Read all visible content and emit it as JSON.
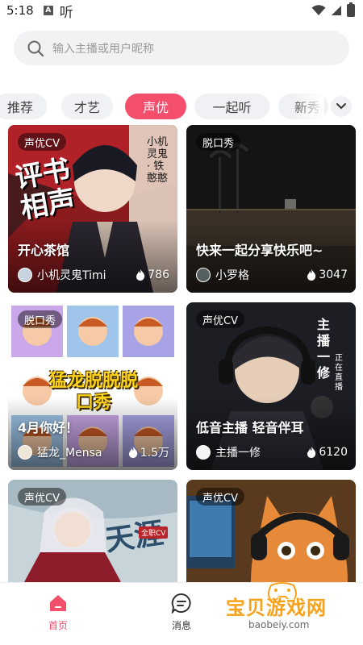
{
  "status_bar": {
    "time": "5:18",
    "notif_letter": "A",
    "app_glyph": "听"
  },
  "search": {
    "placeholder": "输入主播或用户昵称"
  },
  "tabs": [
    {
      "label": "推荐",
      "active": false
    },
    {
      "label": "才艺",
      "active": false
    },
    {
      "label": "声优",
      "active": true
    },
    {
      "label": "一起听",
      "active": false
    },
    {
      "label": "新秀",
      "active": false
    }
  ],
  "cards": [
    {
      "tag": "声优CV",
      "title": "开心茶馆",
      "host": "小机灵鬼Timi",
      "heat": "786",
      "art_text": "评书相声",
      "side_text": "小机灵鬼 · 铁憨憨"
    },
    {
      "tag": "脱口秀",
      "title": "快来一起分享快乐吧~",
      "host": "小罗格",
      "heat": "3047"
    },
    {
      "tag": "脱口秀",
      "title": "4月你好！",
      "host": "猛龙_Mensa",
      "heat": "1.5万",
      "art_text": "猛龙脱脱脱口秀"
    },
    {
      "tag": "声优CV",
      "title": "低音主播 轻音伴耳",
      "host": "主播一修",
      "heat": "6120",
      "side_text": "主播一修",
      "live_text": "正在直播"
    },
    {
      "tag": "声优CV",
      "art_text": "天涯",
      "badge_text": "全职CV"
    },
    {
      "tag": "声优CV"
    }
  ],
  "bottom_nav": [
    {
      "label": "首页",
      "active": true
    },
    {
      "label": "消息",
      "active": false
    }
  ],
  "watermark": {
    "text": "宝贝游戏网",
    "url": "baobeiy.com"
  },
  "colors": {
    "accent": "#f34f6c",
    "tab_bg": "#eff1f5",
    "search_bg": "#f2f2f4",
    "watermark": "#f6a21b"
  }
}
